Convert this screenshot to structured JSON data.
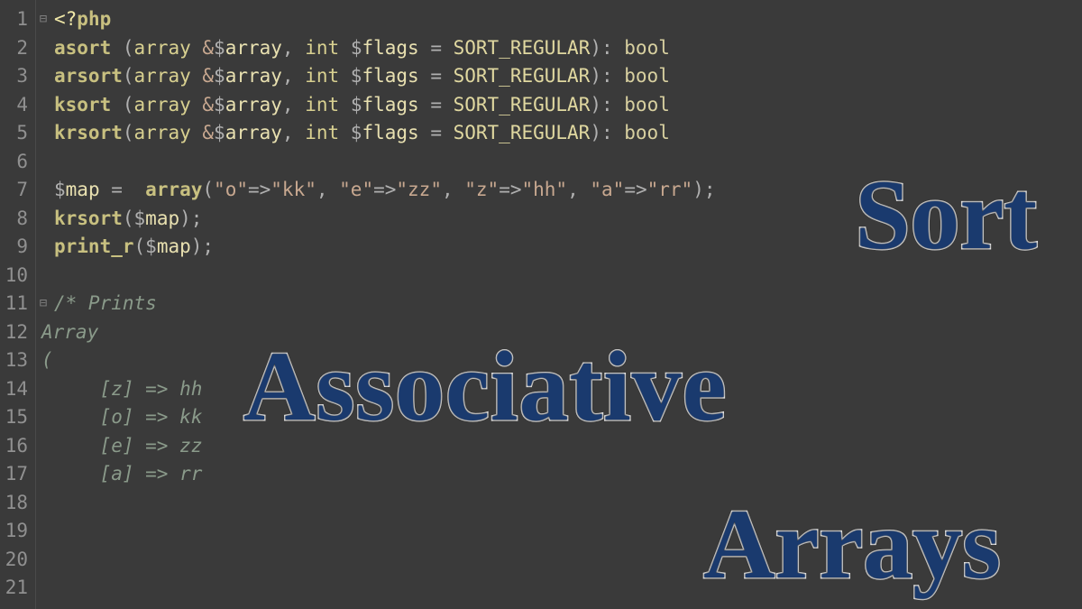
{
  "lines": {
    "count": 21,
    "fold": {
      "1": "⊟",
      "11": "⊟"
    }
  },
  "code": {
    "l1": {
      "open": "<?",
      "php": "php"
    },
    "l2": {
      "fn": "asort",
      "sp": " ",
      "p1": "(",
      "kw1": "array",
      "amp": " &",
      "d1": "$",
      "v1": "array",
      "c1": ", ",
      "kw2": "int",
      "sp2": " ",
      "d2": "$",
      "v2": "flags",
      "eq": " = ",
      "const": "SORT_REGULAR",
      "p2": "): ",
      "ret": "bool"
    },
    "l3": {
      "fn": "arsort",
      "p1": "(",
      "kw1": "array",
      "amp": " &",
      "d1": "$",
      "v1": "array",
      "c1": ", ",
      "kw2": "int",
      "sp2": " ",
      "d2": "$",
      "v2": "flags",
      "eq": " = ",
      "const": "SORT_REGULAR",
      "p2": "): ",
      "ret": "bool"
    },
    "l4": {
      "fn": "ksort",
      "sp": " ",
      "p1": "(",
      "kw1": "array",
      "amp": " &",
      "d1": "$",
      "v1": "array",
      "c1": ", ",
      "kw2": "int",
      "sp2": " ",
      "d2": "$",
      "v2": "flags",
      "eq": " = ",
      "const": "SORT_REGULAR",
      "p2": "): ",
      "ret": "bool"
    },
    "l5": {
      "fn": "krsort",
      "p1": "(",
      "kw1": "array",
      "amp": " &",
      "d1": "$",
      "v1": "array",
      "c1": ", ",
      "kw2": "int",
      "sp2": " ",
      "d2": "$",
      "v2": "flags",
      "eq": " = ",
      "const": "SORT_REGULAR",
      "p2": "): ",
      "ret": "bool"
    },
    "l7": {
      "d1": "$",
      "v1": "map",
      "eq": " =  ",
      "fn": "array",
      "p1": "(",
      "s1": "\"o\"",
      "a1": "=>",
      "s2": "\"kk\"",
      "c1": ", ",
      "s3": "\"e\"",
      "a2": "=>",
      "s4": "\"zz\"",
      "c2": ", ",
      "s5": "\"z\"",
      "a3": "=>",
      "s6": "\"hh\"",
      "c3": ", ",
      "s7": "\"a\"",
      "a4": "=>",
      "s8": "\"rr\"",
      "p2": ");"
    },
    "l8": {
      "fn": "krsort",
      "p1": "(",
      "d1": "$",
      "v1": "map",
      "p2": ");"
    },
    "l9": {
      "fn": "print_r",
      "p1": "(",
      "d1": "$",
      "v1": "map",
      "p2": ");"
    },
    "l11": "/* Prints",
    "l12": "Array",
    "l13": "(",
    "l14": "    [z] => hh",
    "l15": "    [o] => kk",
    "l16": "    [e] => zz",
    "l17": "    [a] => rr"
  },
  "overlay": {
    "sort": "Sort",
    "assoc": "Associative",
    "arrays": "Arrays"
  }
}
